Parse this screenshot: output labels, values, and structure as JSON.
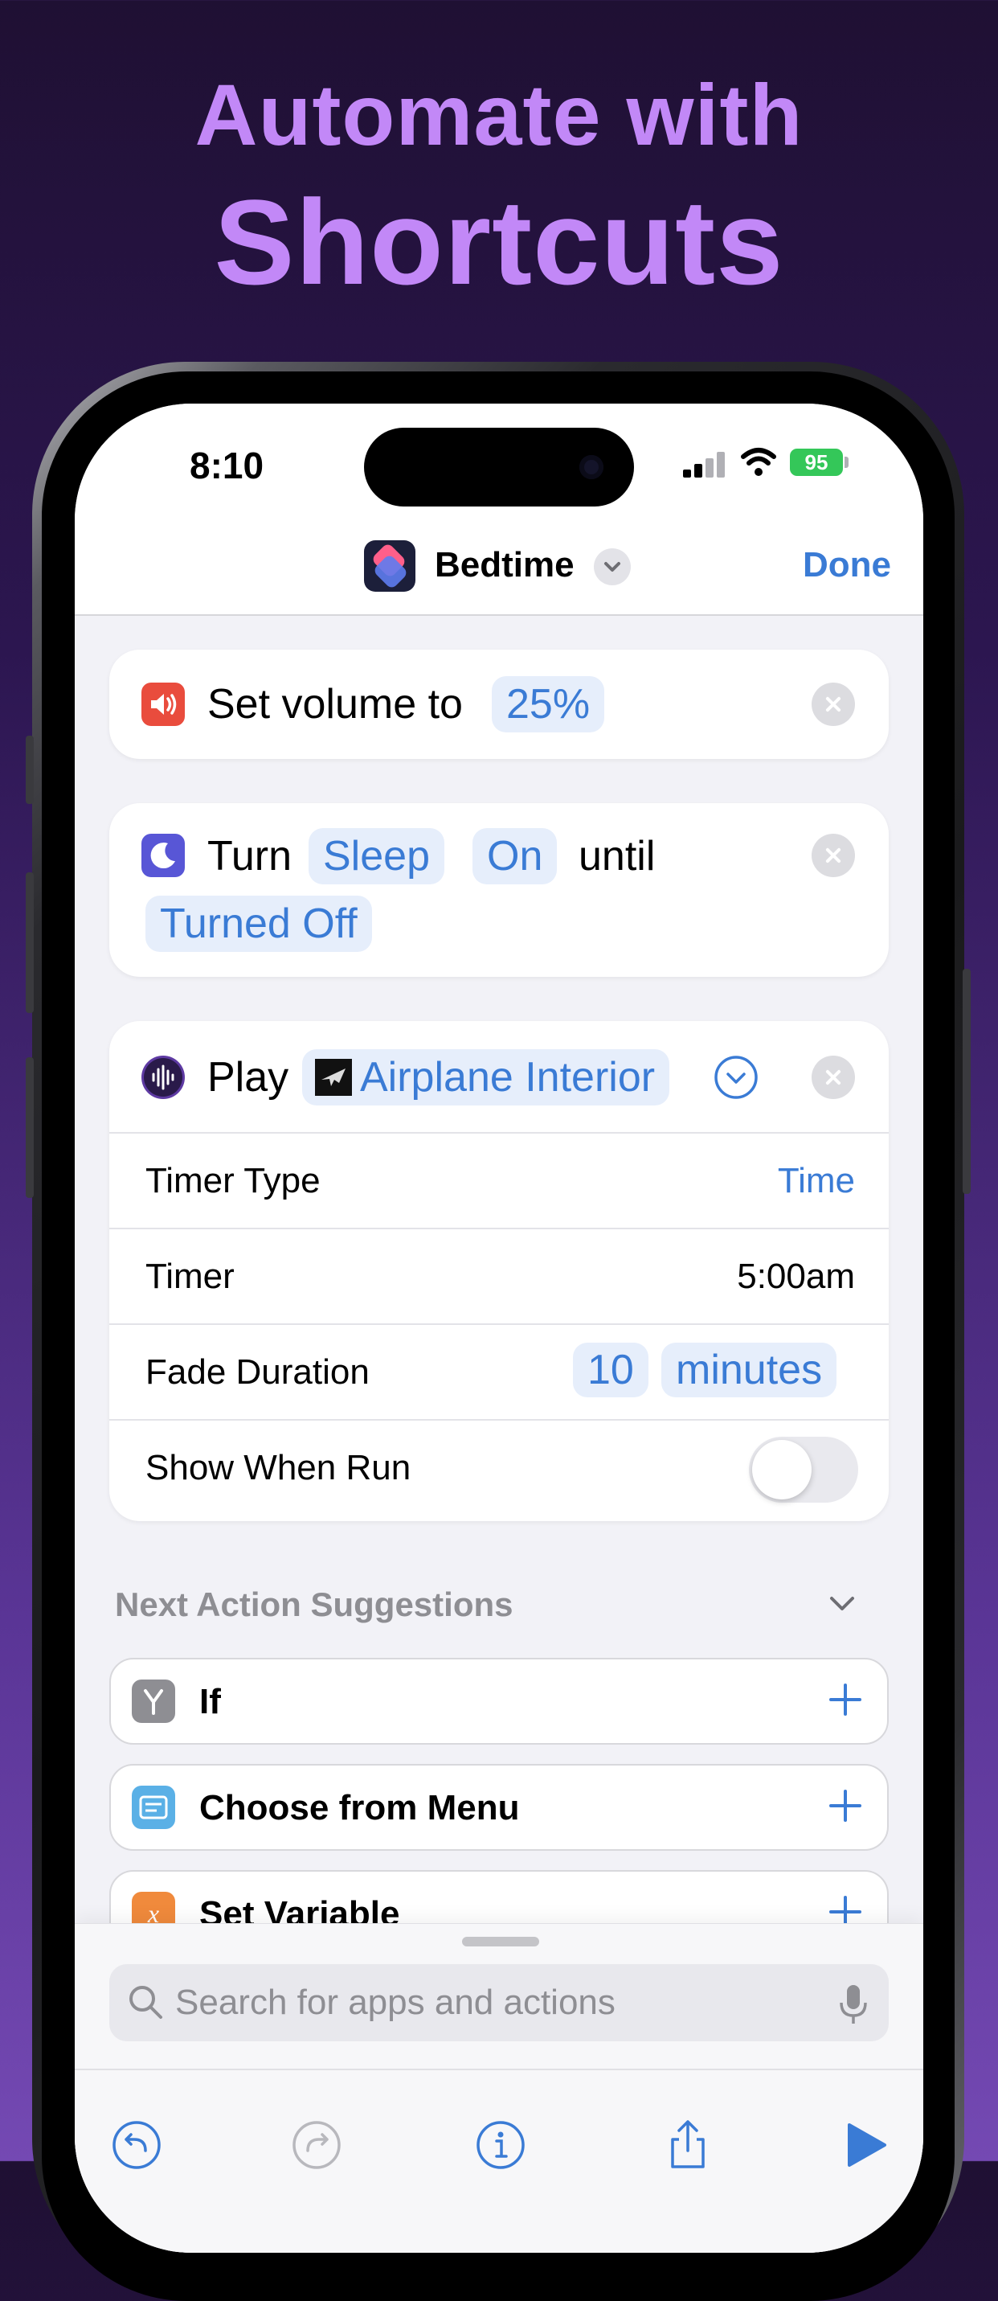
{
  "headline": {
    "line1": "Automate with",
    "line2": "Shortcuts"
  },
  "status_bar": {
    "time": "8:10",
    "battery": "95"
  },
  "nav": {
    "title": "Bedtime",
    "done_label": "Done",
    "app_icon": "shortcuts-app-icon"
  },
  "actions": [
    {
      "icon": "speaker-icon",
      "icon_color": "#e94c3d",
      "words": [
        "Set volume to"
      ],
      "pills": [
        "25%"
      ]
    },
    {
      "icon": "moon-icon",
      "icon_color": "#5856d6",
      "words": [
        "Turn",
        "until"
      ],
      "pills": [
        "Sleep",
        "On",
        "Turned Off"
      ]
    },
    {
      "icon": "waveform-icon",
      "icon_color": "#5e3aa3",
      "words": [
        "Play"
      ],
      "pills": [
        "Airplane Interior"
      ],
      "params": [
        {
          "label": "Timer Type",
          "value": "Time",
          "value_color": "#3a7bd5"
        },
        {
          "label": "Timer",
          "value": "5:00am",
          "value_color": "#000000"
        },
        {
          "label": "Fade Duration",
          "pills": [
            "10",
            "minutes"
          ]
        },
        {
          "label": "Show When Run",
          "toggle": false
        }
      ]
    }
  ],
  "suggestions": {
    "title": "Next Action Suggestions",
    "items": [
      {
        "label": "If",
        "icon": "branch-icon",
        "icon_color": "#8e8e93"
      },
      {
        "label": "Choose from Menu",
        "icon": "menu-icon",
        "icon_color": "#5ab0e6"
      },
      {
        "label": "Set Variable",
        "icon": "variable-icon",
        "icon_color": "#f08a3c"
      }
    ]
  },
  "search": {
    "placeholder": "Search for apps and actions"
  },
  "toolbar": [
    "undo-icon",
    "redo-icon",
    "info-icon",
    "share-icon",
    "play-icon"
  ],
  "colors": {
    "accent": "#3a7bd5",
    "headline": "#c288f7"
  }
}
